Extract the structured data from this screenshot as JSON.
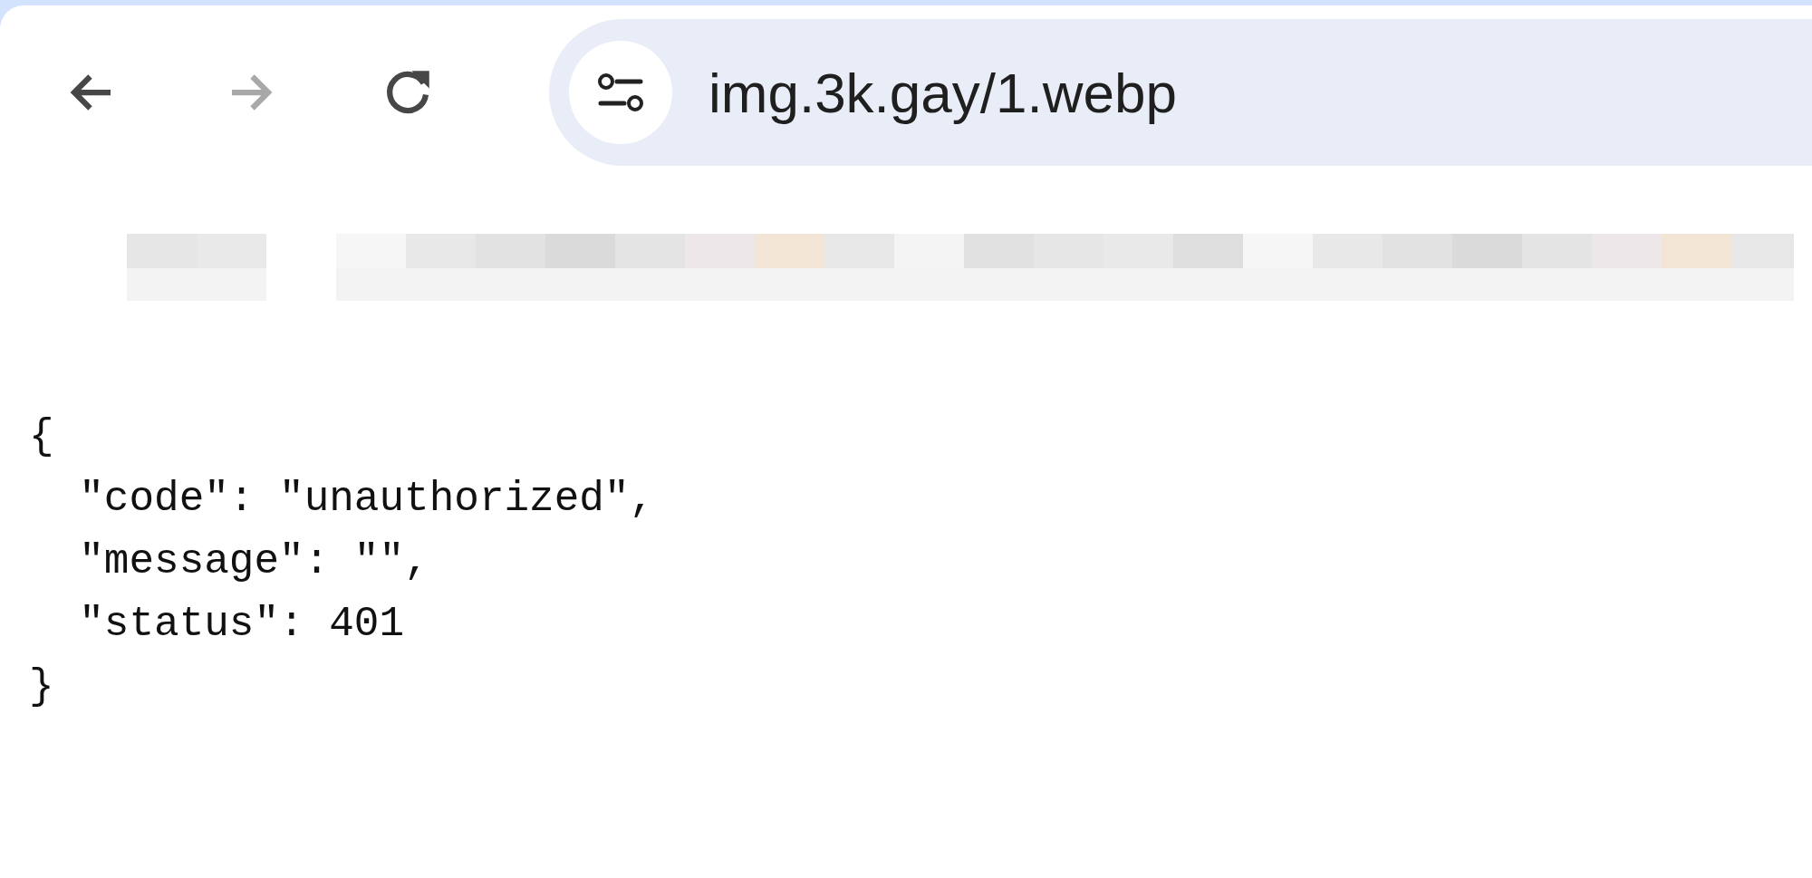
{
  "toolbar": {
    "buttons": [
      {
        "kind": "back",
        "disabled": false
      },
      {
        "kind": "forward",
        "disabled": true
      },
      {
        "kind": "reload",
        "disabled": false
      }
    ]
  },
  "address_bar": {
    "url": "img.3k.gay/1.webp"
  },
  "response_lines": [
    "{",
    "  \"code\": \"unauthorized\",",
    "  \"message\": \"\",",
    "  \"status\": 401",
    "}"
  ]
}
